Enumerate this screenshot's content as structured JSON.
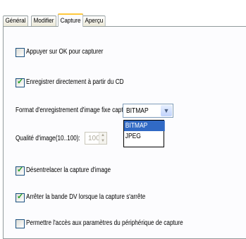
{
  "tabs": [
    {
      "label": "Général"
    },
    {
      "label": "Modifier"
    },
    {
      "label": "Capture"
    },
    {
      "label": "Aperçu"
    }
  ],
  "active_tab": "Capture",
  "options": [
    {
      "label": "Appuyer sur OK pour capturer",
      "checked": false
    },
    {
      "label": "Enregistrer directement à partir du CD",
      "checked": true
    },
    {
      "label": "Désentrelacer la capture d'image",
      "checked": true
    },
    {
      "label": "Arrêter la bande DV lorsque la capture s'arrête",
      "checked": true
    },
    {
      "label": "Permettre l'accès aux paramètres du périphérique de capture",
      "checked": false
    }
  ],
  "format": {
    "label": "Format d'enregistrement d'image fixe capturée:",
    "value": "BITMAP",
    "options": [
      "BITMAP",
      "JPEG"
    ]
  },
  "quality": {
    "label": "Qualité d'image(10..100):",
    "value": "100"
  },
  "colors": {
    "selection": "#316ac5",
    "check": "#21a121",
    "active_tab_accent": "#ffc83c"
  }
}
